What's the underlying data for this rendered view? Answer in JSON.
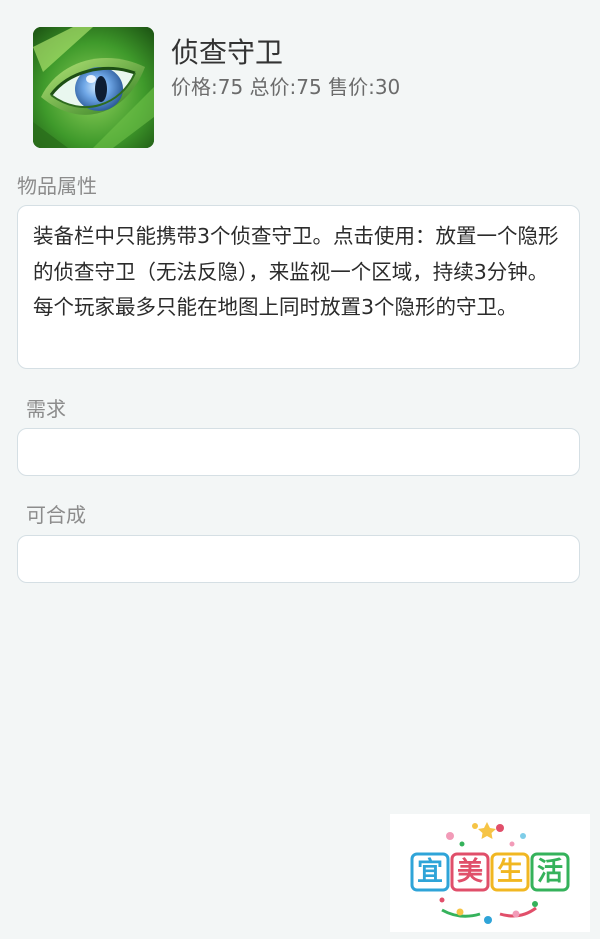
{
  "item": {
    "name": "侦查守卫",
    "price_line": "价格:75 总价:75 售价:30"
  },
  "sections": {
    "attributes_label": "物品属性",
    "description": "装备栏中只能携带3个侦查守卫。点击使用：放置一个隐形的侦查守卫（无法反隐），来监视一个区域，持续3分钟。每个玩家最多只能在地图上同时放置3个隐形的守卫。",
    "requirements_label": "需求",
    "requirements_value": "",
    "craftable_label": "可合成",
    "craftable_value": ""
  },
  "watermark": {
    "text": "宜美生活",
    "char_colors": [
      "#2fa4d8",
      "#e04f6a",
      "#f1b722",
      "#35b25b"
    ]
  },
  "icons": {
    "item_icon": "green-eye-ward-icon"
  }
}
